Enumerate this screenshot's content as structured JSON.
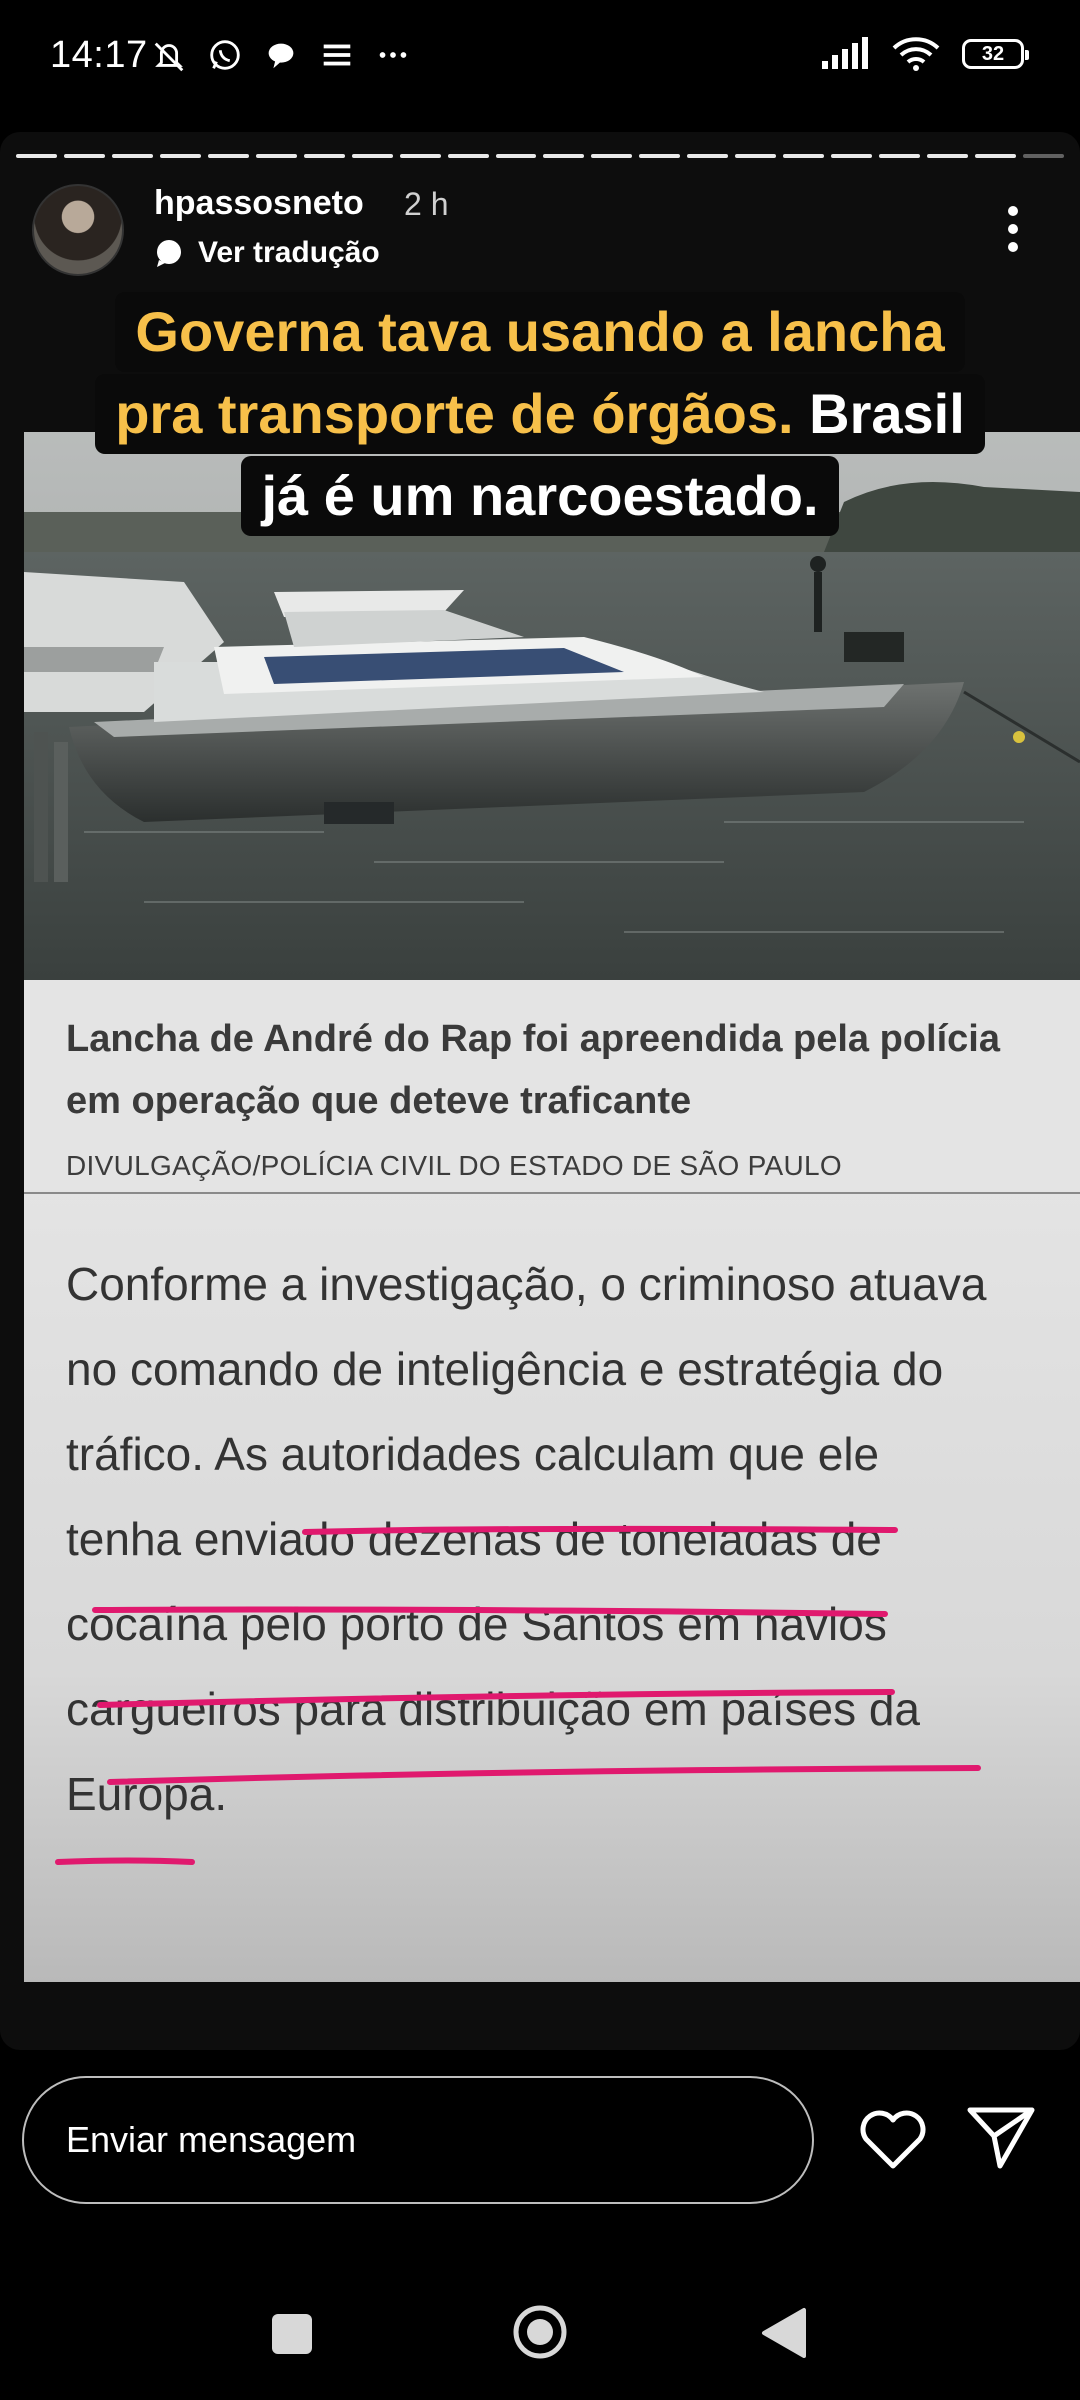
{
  "status_bar": {
    "time": "14:17",
    "battery": "32",
    "icons_left": [
      "mute-icon",
      "whatsapp-icon",
      "chat-bubble-icon",
      "list-icon",
      "more-dots-icon"
    ],
    "icons_right": [
      "signal-icon",
      "wifi-icon",
      "battery-icon"
    ]
  },
  "story": {
    "progress_segments_total": 22,
    "progress_segments_viewed": 21,
    "username": "hpassosneto",
    "time_ago": "2 h",
    "translate_label": "Ver tradução",
    "overlay_headline": {
      "line1": "Governa tava usando a lancha",
      "line2_yellow": "pra transporte de órgãos.",
      "line2_white": "Brasil",
      "line3": "já é um narcoestado."
    },
    "article": {
      "caption": "Lancha de André do Rap foi apreendida pela polícia em operação que deteve traficante",
      "credit": "DIVULGAÇÃO/POLÍCIA CIVIL DO ESTADO DE SÃO PAULO",
      "body_lines": [
        "Conforme a investigação, o criminoso atuava",
        "no comando de inteligência e estratégia do",
        "tráfico. As autoridades calculam que ele",
        "tenha enviado dezenas de toneladas de",
        "cocaína pelo porto de Santos em navios",
        "cargueiros para distribuição em países da",
        "Europa."
      ]
    },
    "colors": {
      "headline_yellow": "#f7c04a",
      "underline_pink": "#e0196e"
    }
  },
  "reply_bar": {
    "placeholder": "Enviar mensagem"
  },
  "nav_bar": {
    "buttons": [
      "recent-apps",
      "home",
      "back"
    ]
  }
}
